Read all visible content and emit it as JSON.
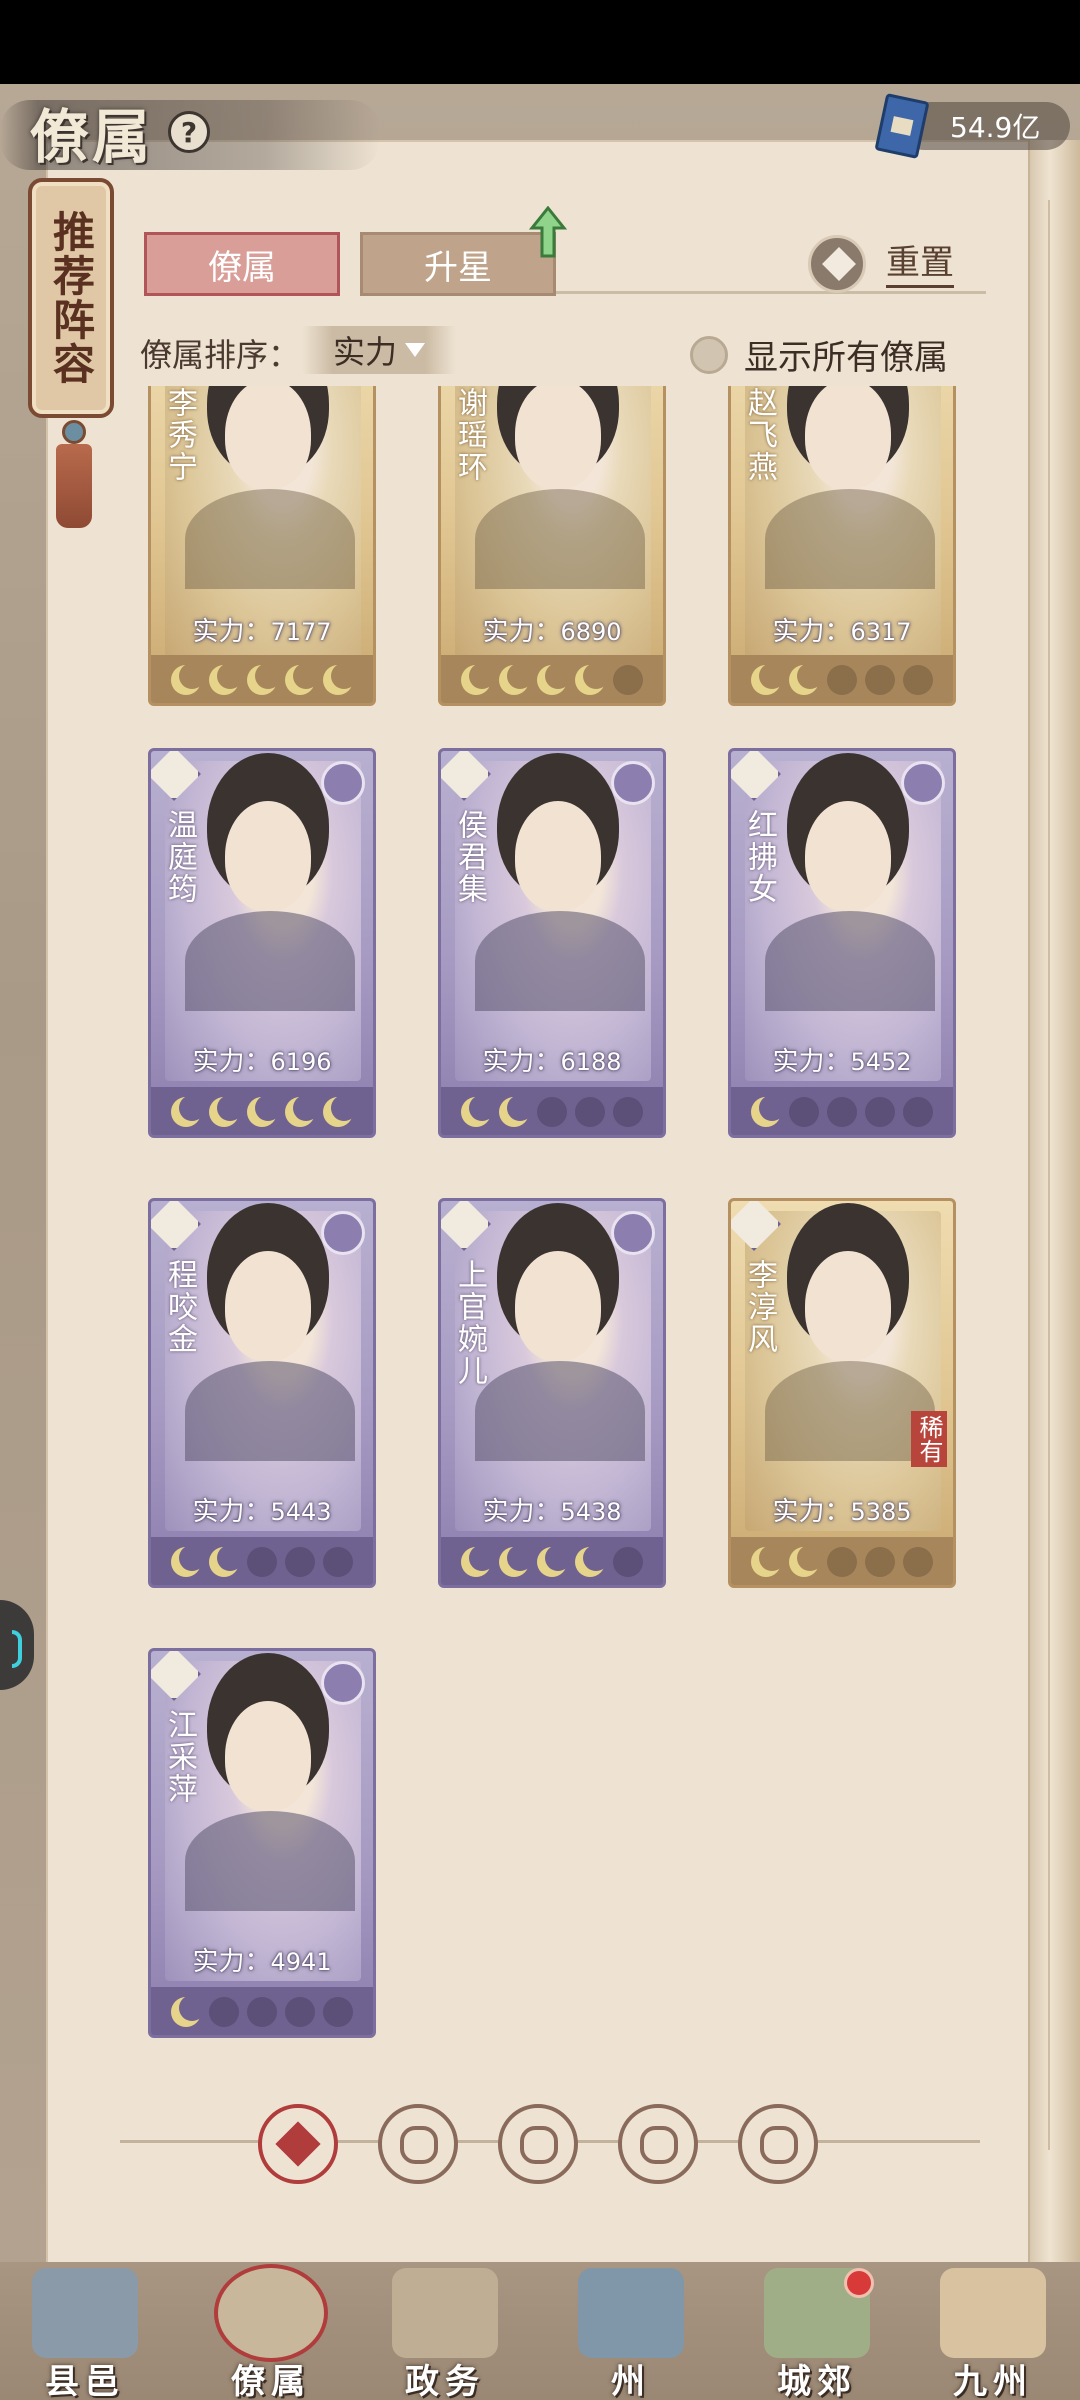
{
  "header": {
    "title": "僚属",
    "help_symbol": "?",
    "currency_value": "54.9亿"
  },
  "recommend_tag": "推荐阵容",
  "tabs": [
    {
      "label": "僚属",
      "active": true
    },
    {
      "label": "升星",
      "active": false
    }
  ],
  "reset_label": "重置",
  "sort": {
    "label": "僚属排序：",
    "selected": "实力"
  },
  "show_all_label": "显示所有僚属",
  "power_prefix": "实力：",
  "cards": [
    {
      "name": "李秀宁",
      "power": "7177",
      "frame": "gold",
      "stars_on": 5,
      "stars_total": 5
    },
    {
      "name": "谢瑶环",
      "power": "6890",
      "frame": "gold",
      "stars_on": 4,
      "stars_total": 5
    },
    {
      "name": "赵飞燕",
      "power": "6317",
      "frame": "gold",
      "stars_on": 2,
      "stars_total": 5
    },
    {
      "name": "温庭筠",
      "power": "6196",
      "frame": "purple",
      "stars_on": 5,
      "stars_total": 5
    },
    {
      "name": "侯君集",
      "power": "6188",
      "frame": "purple",
      "stars_on": 2,
      "stars_total": 5
    },
    {
      "name": "红拂女",
      "power": "5452",
      "frame": "purple",
      "stars_on": 1,
      "stars_total": 5
    },
    {
      "name": "程咬金",
      "power": "5443",
      "frame": "purple",
      "stars_on": 2,
      "stars_total": 5
    },
    {
      "name": "上官婉儿",
      "power": "5438",
      "frame": "purple",
      "stars_on": 4,
      "stars_total": 5
    },
    {
      "name": "李淳风",
      "power": "5385",
      "frame": "gold",
      "stars_on": 2,
      "stars_total": 5,
      "tag": "稀有"
    },
    {
      "name": "江采萍",
      "power": "4941",
      "frame": "purple",
      "stars_on": 1,
      "stars_total": 5
    }
  ],
  "filters": [
    {
      "icon": "all-diamond-icon",
      "active": true
    },
    {
      "icon": "helmet-icon",
      "active": false
    },
    {
      "icon": "gourd-icon",
      "active": false
    },
    {
      "icon": "fan-icon",
      "active": false
    },
    {
      "icon": "beast-icon",
      "active": false
    }
  ],
  "bottom_nav": [
    {
      "label": "县邑",
      "icon": "county-gate-icon",
      "active": false
    },
    {
      "label": "僚属",
      "icon": "retainers-scroll-icon",
      "active": true
    },
    {
      "label": "政务",
      "icon": "affairs-scroll-icon",
      "active": false
    },
    {
      "label": "州",
      "icon": "prefecture-mountain-icon",
      "active": false
    },
    {
      "label": "城郊",
      "icon": "suburb-field-icon",
      "active": false,
      "notify": true
    },
    {
      "label": "九州",
      "icon": "map-scroll-icon",
      "active": false
    }
  ]
}
